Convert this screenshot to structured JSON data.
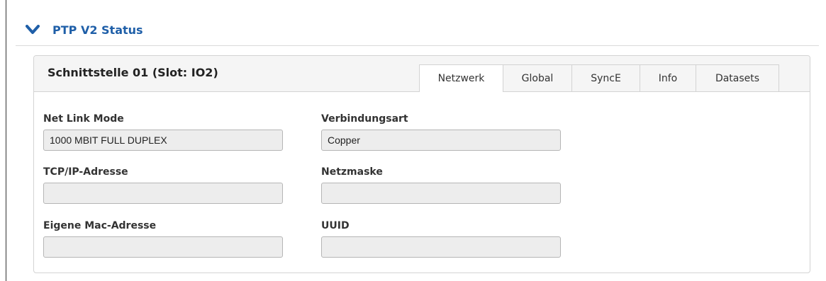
{
  "section": {
    "title": "PTP V2 Status",
    "collapse_icon": "chevron-down-icon"
  },
  "panel": {
    "title": "Schnittstelle 01 (Slot: IO2)",
    "tabs": [
      {
        "label": "Netzwerk",
        "active": true
      },
      {
        "label": "Global",
        "active": false
      },
      {
        "label": "SyncE",
        "active": false
      },
      {
        "label": "Info",
        "active": false
      },
      {
        "label": "Datasets",
        "active": false
      }
    ]
  },
  "fields": {
    "net_link_mode": {
      "label": "Net Link Mode",
      "value": "1000 MBIT FULL DUPLEX"
    },
    "verbindungsart": {
      "label": "Verbindungsart",
      "value": "Copper"
    },
    "tcp_ip": {
      "label": "TCP/IP-Adresse",
      "value": ""
    },
    "netzmaske": {
      "label": "Netzmaske",
      "value": ""
    },
    "mac": {
      "label": "Eigene Mac-Adresse",
      "value": ""
    },
    "uuid": {
      "label": "UUID",
      "value": ""
    }
  },
  "colors": {
    "accent": "#1f5fa8",
    "panel_header_bg": "#f5f5f5",
    "input_bg": "#ededed"
  }
}
